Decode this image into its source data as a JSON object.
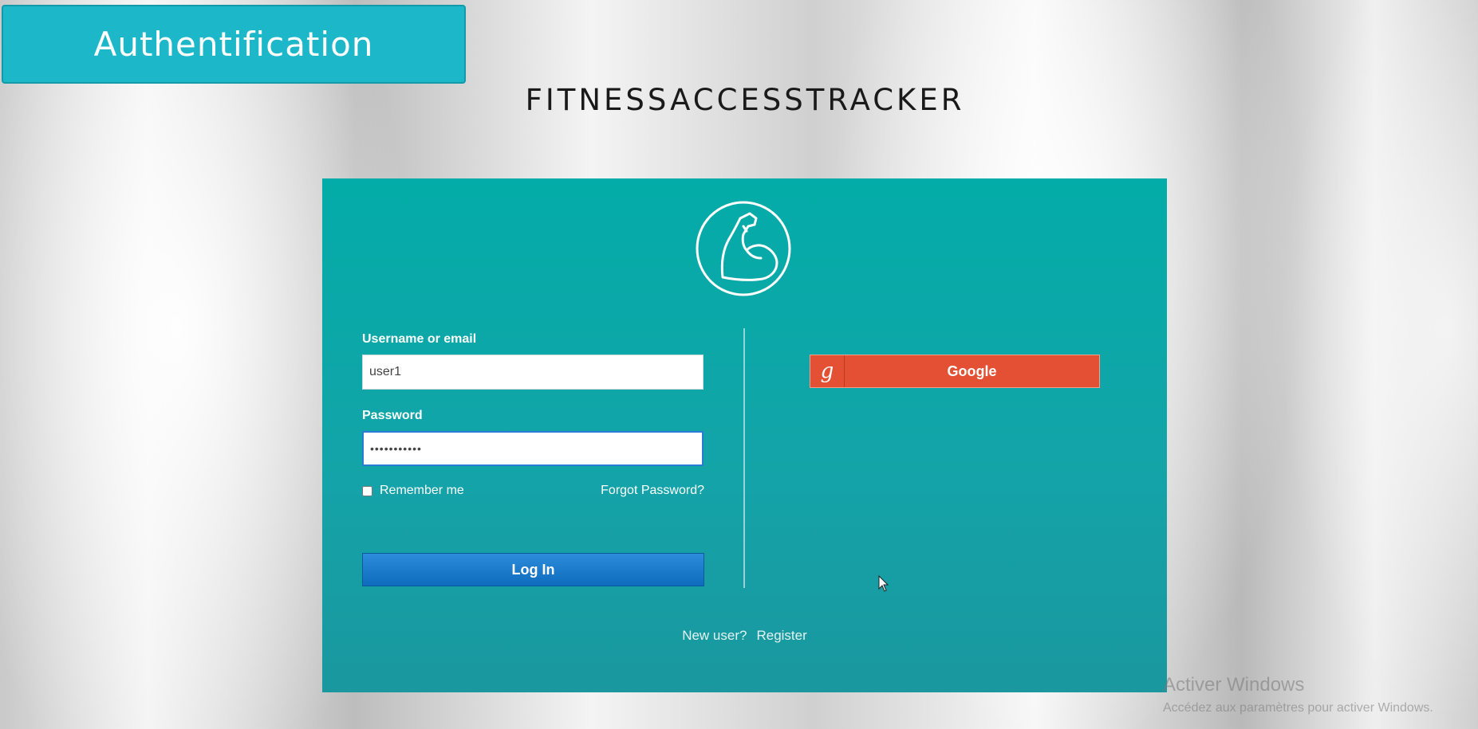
{
  "header": {
    "badge_text": "Authentification"
  },
  "app": {
    "title": "FITNESSACCESSTRACKER"
  },
  "logo": {
    "icon": "flexed-arm-icon"
  },
  "form": {
    "username_label": "Username or email",
    "username_value": "user1",
    "password_label": "Password",
    "password_value": "•••••••••••",
    "remember_label": "Remember me",
    "forgot_label": "Forgot Password?",
    "login_label": "Log In"
  },
  "social": {
    "google_icon_glyph": "g",
    "google_label": "Google"
  },
  "register": {
    "prompt": "New user?",
    "link_label": "Register"
  },
  "watermark": {
    "line1": "Activer Windows",
    "line2": "Accédez aux paramètres pour activer Windows."
  },
  "colors": {
    "panel": "#0aa8a6",
    "badge": "#1cb8c9",
    "login_button": "#1a78c8",
    "google_button": "#e35033"
  }
}
